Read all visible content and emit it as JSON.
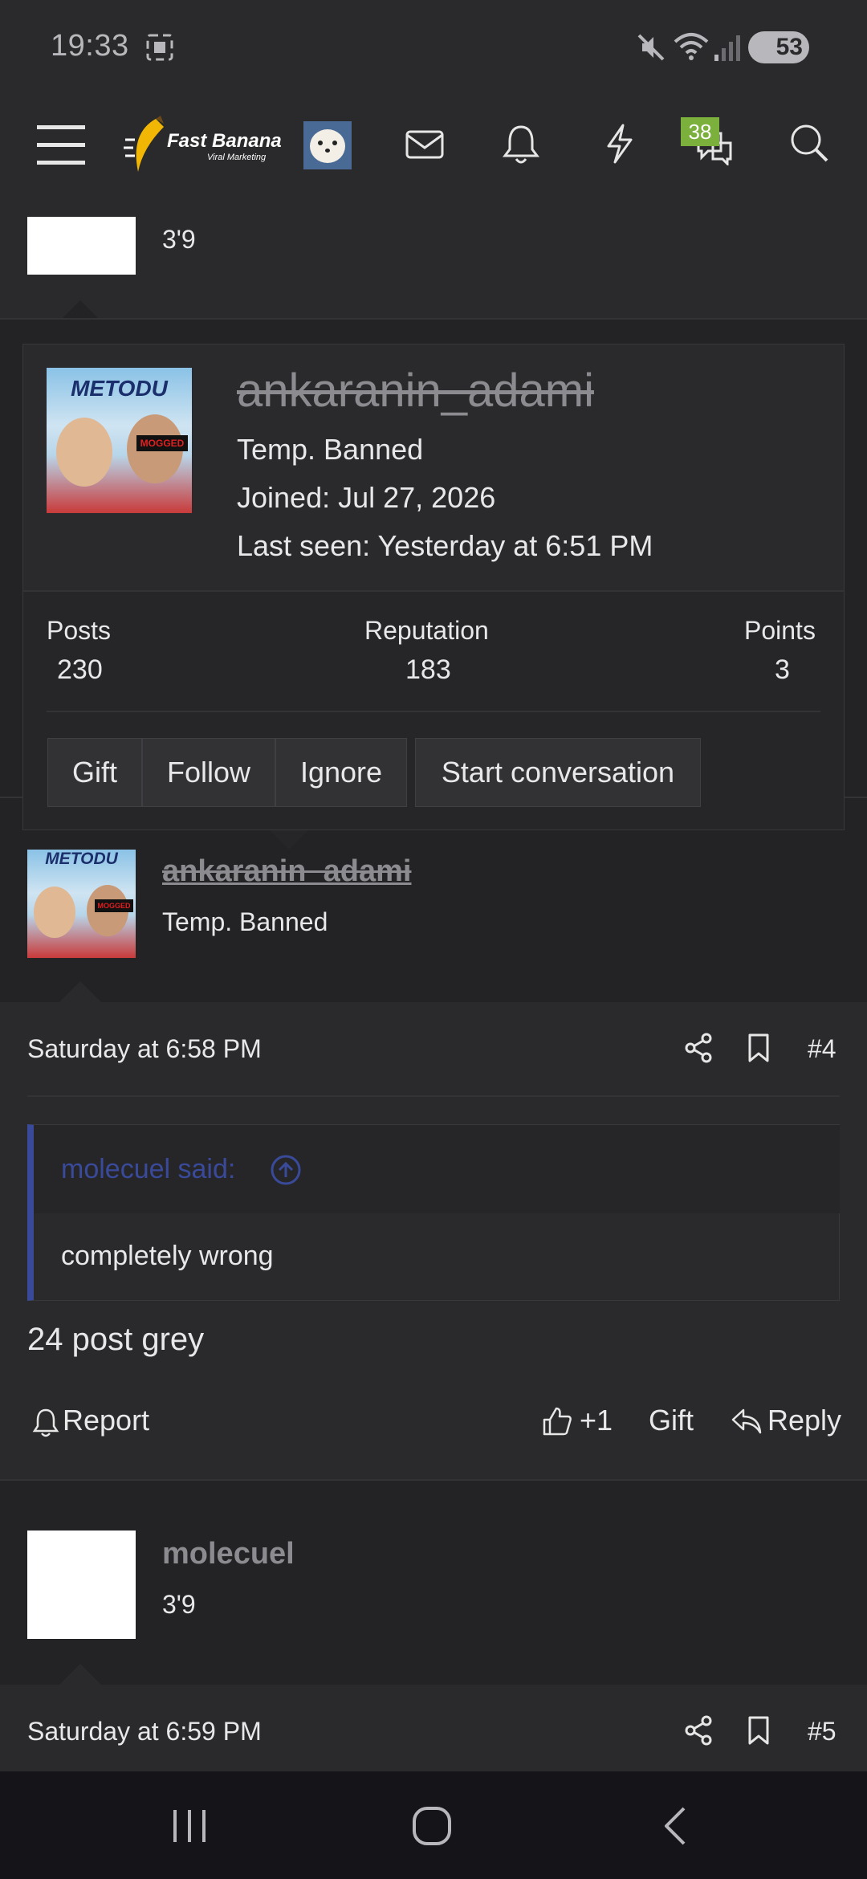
{
  "status_bar": {
    "time": "19:33",
    "battery": "53"
  },
  "nav": {
    "logo_text": "Fast Banana",
    "logo_subtext": "Viral Marketing",
    "messages_badge": "38"
  },
  "prev_post": {
    "user_title": "3'9"
  },
  "popup": {
    "username": "ankaranin_adami",
    "status": "Temp. Banned",
    "joined": "Joined: Jul 27, 2026",
    "last_seen": "Last seen: Yesterday at 6:51 PM",
    "avatar_title": "METODU",
    "avatar_tag": "MOGGED",
    "stats": [
      {
        "label": "Posts",
        "value": "230"
      },
      {
        "label": "Reputation",
        "value": "183"
      },
      {
        "label": "Points",
        "value": "3"
      }
    ],
    "buttons": {
      "gift": "Gift",
      "follow": "Follow",
      "ignore": "Ignore",
      "start_conversation": "Start conversation"
    }
  },
  "post4": {
    "username": "ankaranin_adami",
    "user_title": "Temp. Banned",
    "avatar_title": "METODU",
    "avatar_tag": "MOGGED",
    "date": "Saturday at 6:58 PM",
    "number": "#4",
    "quote_author": "molecuel said:",
    "quote_text": "completely wrong",
    "body": "24 post grey",
    "report": "Report",
    "like": "+1",
    "gift": "Gift",
    "reply": "Reply"
  },
  "post5": {
    "username": "molecuel",
    "user_title": "3'9",
    "date": "Saturday at 6:59 PM",
    "number": "#5"
  },
  "colors": {
    "background": "#232325",
    "panel": "#2a2a2c",
    "badge": "#7bb03c",
    "quote_bar": "#3a4a9a",
    "quote_author": "#3a4a9a"
  }
}
